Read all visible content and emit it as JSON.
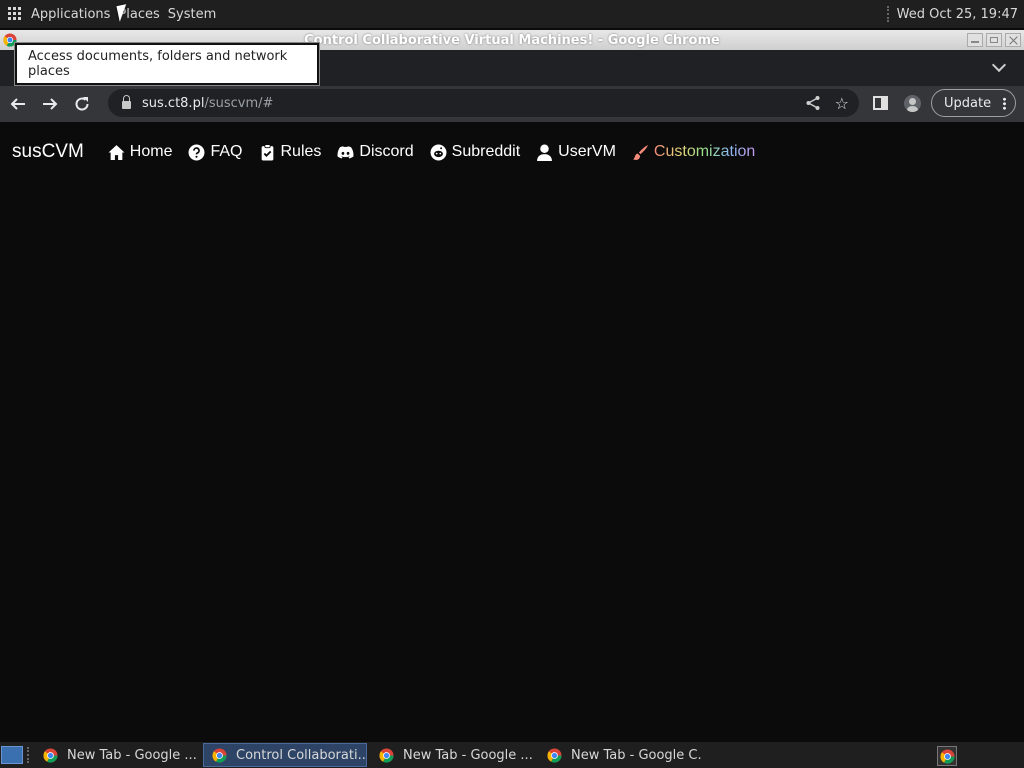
{
  "top_panel": {
    "menus": [
      "Applications",
      "Places",
      "System"
    ],
    "clock": "Wed Oct 25, 19:47"
  },
  "tooltip": "Access documents, folders and network places",
  "window": {
    "title": "Control Collaborative Virtual Machines! - Google Chrome"
  },
  "toolbar": {
    "url_host": "sus.ct8.pl",
    "url_path": "/suscvm/#",
    "update_label": "Update"
  },
  "site": {
    "brand": "susCVM",
    "nav": [
      {
        "label": "Home",
        "icon": "home-icon"
      },
      {
        "label": "FAQ",
        "icon": "question-circle-icon"
      },
      {
        "label": "Rules",
        "icon": "clipboard-check-icon"
      },
      {
        "label": "Discord",
        "icon": "discord-icon"
      },
      {
        "label": "Subreddit",
        "icon": "reddit-icon"
      },
      {
        "label": "UserVM",
        "icon": "user-icon"
      },
      {
        "label": "Customization",
        "icon": "paintbrush-icon"
      }
    ]
  },
  "taskbar": {
    "items": [
      {
        "label": "New Tab - Google ...",
        "active": false
      },
      {
        "label": "Control Collaborati...",
        "active": true
      },
      {
        "label": "New Tab - Google ...",
        "active": false
      },
      {
        "label": "New Tab - Google C...",
        "active": false
      }
    ]
  },
  "colors": {
    "page_bg": "#0b0b0b",
    "toolbar_bg": "#35363a",
    "panel_bg": "#1f1f1f",
    "customization_accent": "#f48a7a"
  }
}
